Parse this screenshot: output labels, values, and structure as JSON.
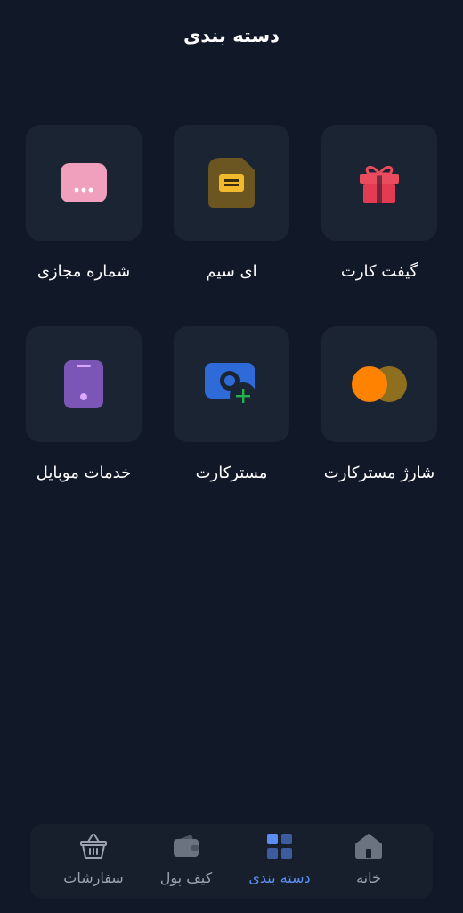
{
  "header": {
    "title": "دسته بندی"
  },
  "categories": [
    {
      "label": "گیفت کارت",
      "icon": "gift-icon"
    },
    {
      "label": "ای سیم",
      "icon": "esim-icon"
    },
    {
      "label": "شماره مجازی",
      "icon": "virtual-number-icon"
    },
    {
      "label": "شارژ مسترکارت",
      "icon": "mastercard-icon"
    },
    {
      "label": "مسترکارت",
      "icon": "add-card-icon"
    },
    {
      "label": "خدمات موبایل",
      "icon": "mobile-icon"
    }
  ],
  "bottom_nav": [
    {
      "label": "خانه",
      "icon": "home-icon",
      "active": false
    },
    {
      "label": "دسته بندی",
      "icon": "grid-icon",
      "active": true
    },
    {
      "label": "کیف پول",
      "icon": "wallet-icon",
      "active": false
    },
    {
      "label": "سفارشات",
      "icon": "basket-icon",
      "active": false
    }
  ],
  "colors": {
    "background": "#111827",
    "tile": "#1b2433",
    "accent": "#5b8ef0",
    "inactive": "#9ca3af"
  }
}
